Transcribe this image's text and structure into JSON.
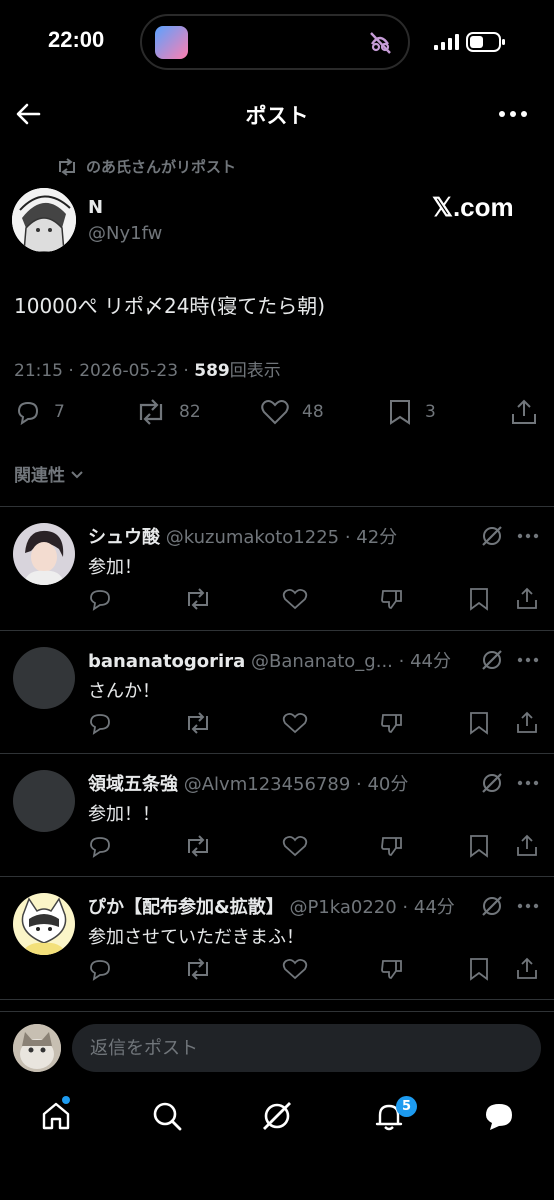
{
  "status_bar": {
    "time": "22:00"
  },
  "header": {
    "title": "ポスト"
  },
  "repost": {
    "text": "のあ氏さんがリポスト"
  },
  "post": {
    "author_name": "N",
    "author_handle": "@Ny1fw",
    "watermark": "𝕏.com",
    "text": "10000ぺ リポ〆24時(寝てたら朝)",
    "time": "21:15",
    "date": "2026-05-23",
    "views": "589",
    "views_label": "回表示",
    "replies": "7",
    "reposts": "82",
    "likes": "48",
    "bookmarks": "3"
  },
  "sort": {
    "label": "関連性"
  },
  "replies": [
    {
      "name": "シュウ酸",
      "handle": "@kuzumakoto1225",
      "time": "42分",
      "text": "参加！"
    },
    {
      "name": "bananatogorira",
      "handle": "@Bananato_g...",
      "time": "44分",
      "text": "さんか！"
    },
    {
      "name": "領域五条強",
      "handle": "@Alvm123456789",
      "time": "40分",
      "text": "参加！！"
    },
    {
      "name": "ぴか【配布参加&拡散】",
      "handle": "@P1ka0220",
      "time": "44分",
      "text": "参加させていただきまふ！"
    }
  ],
  "composer": {
    "placeholder": "返信をポスト"
  },
  "nav": {
    "notifications_count": "5"
  },
  "colors": {
    "accent": "#1d9bf0",
    "background": "#000000",
    "muted": "#71767b",
    "text": "#e7e9ea"
  }
}
